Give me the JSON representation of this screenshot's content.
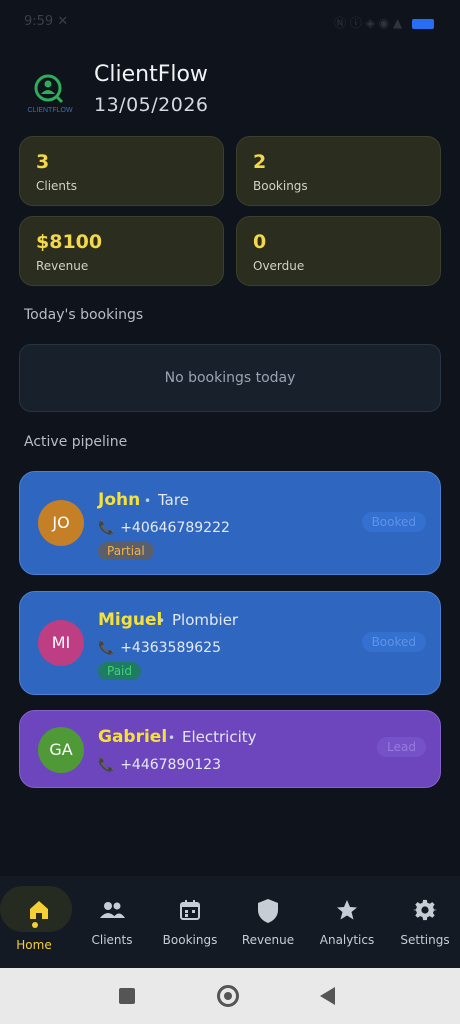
{
  "statusbar": {
    "time": "9:59 ✕",
    "right": "Ⓝ ⓘ ◈ ◉ ▲"
  },
  "header": {
    "title": "ClientFlow",
    "date": "13/05/2026",
    "logo_text": "CLIENTFLOW"
  },
  "stats": [
    {
      "value": "3",
      "label": "Clients"
    },
    {
      "value": "2",
      "label": "Bookings"
    },
    {
      "value": "$8100",
      "label": "Revenue"
    },
    {
      "value": "0",
      "label": "Overdue"
    }
  ],
  "today": {
    "title": "Today's bookings",
    "empty": "No bookings today"
  },
  "pipeline": {
    "title": "Active pipeline",
    "clients": [
      {
        "initials": "JO",
        "name": "John",
        "role": "Tare",
        "phone": "+40646789222",
        "badge": "Partial",
        "stage": "Booked"
      },
      {
        "initials": "MI",
        "name": "Miguel",
        "role": "Plombier",
        "phone": "+4363589625",
        "badge": "Paid",
        "stage": "Booked"
      },
      {
        "initials": "GA",
        "name": "Gabriel",
        "role": "Electricity",
        "phone": "+4467890123",
        "badge": "",
        "stage": "Lead"
      }
    ]
  },
  "nav": [
    {
      "label": "Home",
      "icon": "home-icon"
    },
    {
      "label": "Clients",
      "icon": "people-icon"
    },
    {
      "label": "Bookings",
      "icon": "calendar-icon"
    },
    {
      "label": "Revenue",
      "icon": "shield-icon"
    },
    {
      "label": "Analytics",
      "icon": "star-icon"
    },
    {
      "label": "Settings",
      "icon": "gear-icon"
    }
  ],
  "colors": {
    "accent": "#f5cf33",
    "card_blue": "#2f66c0",
    "card_purple": "#6d46bd",
    "stat_bg": "#2b2e1e"
  }
}
